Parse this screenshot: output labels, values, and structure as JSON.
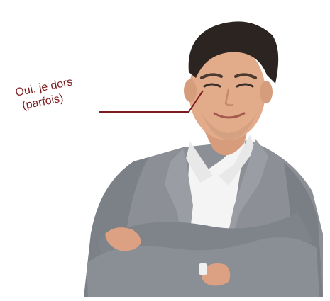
{
  "annotation": {
    "line1": "Oui, je dors",
    "line2": "(parfois)",
    "color": "#7b1a1f"
  },
  "palette": {
    "background": "#ffffff",
    "suit": "#8c9096",
    "suit_dark": "#6f737a",
    "shirt": "#f3f3f3",
    "skin": "#e0a887",
    "hair": "#2b2420"
  }
}
